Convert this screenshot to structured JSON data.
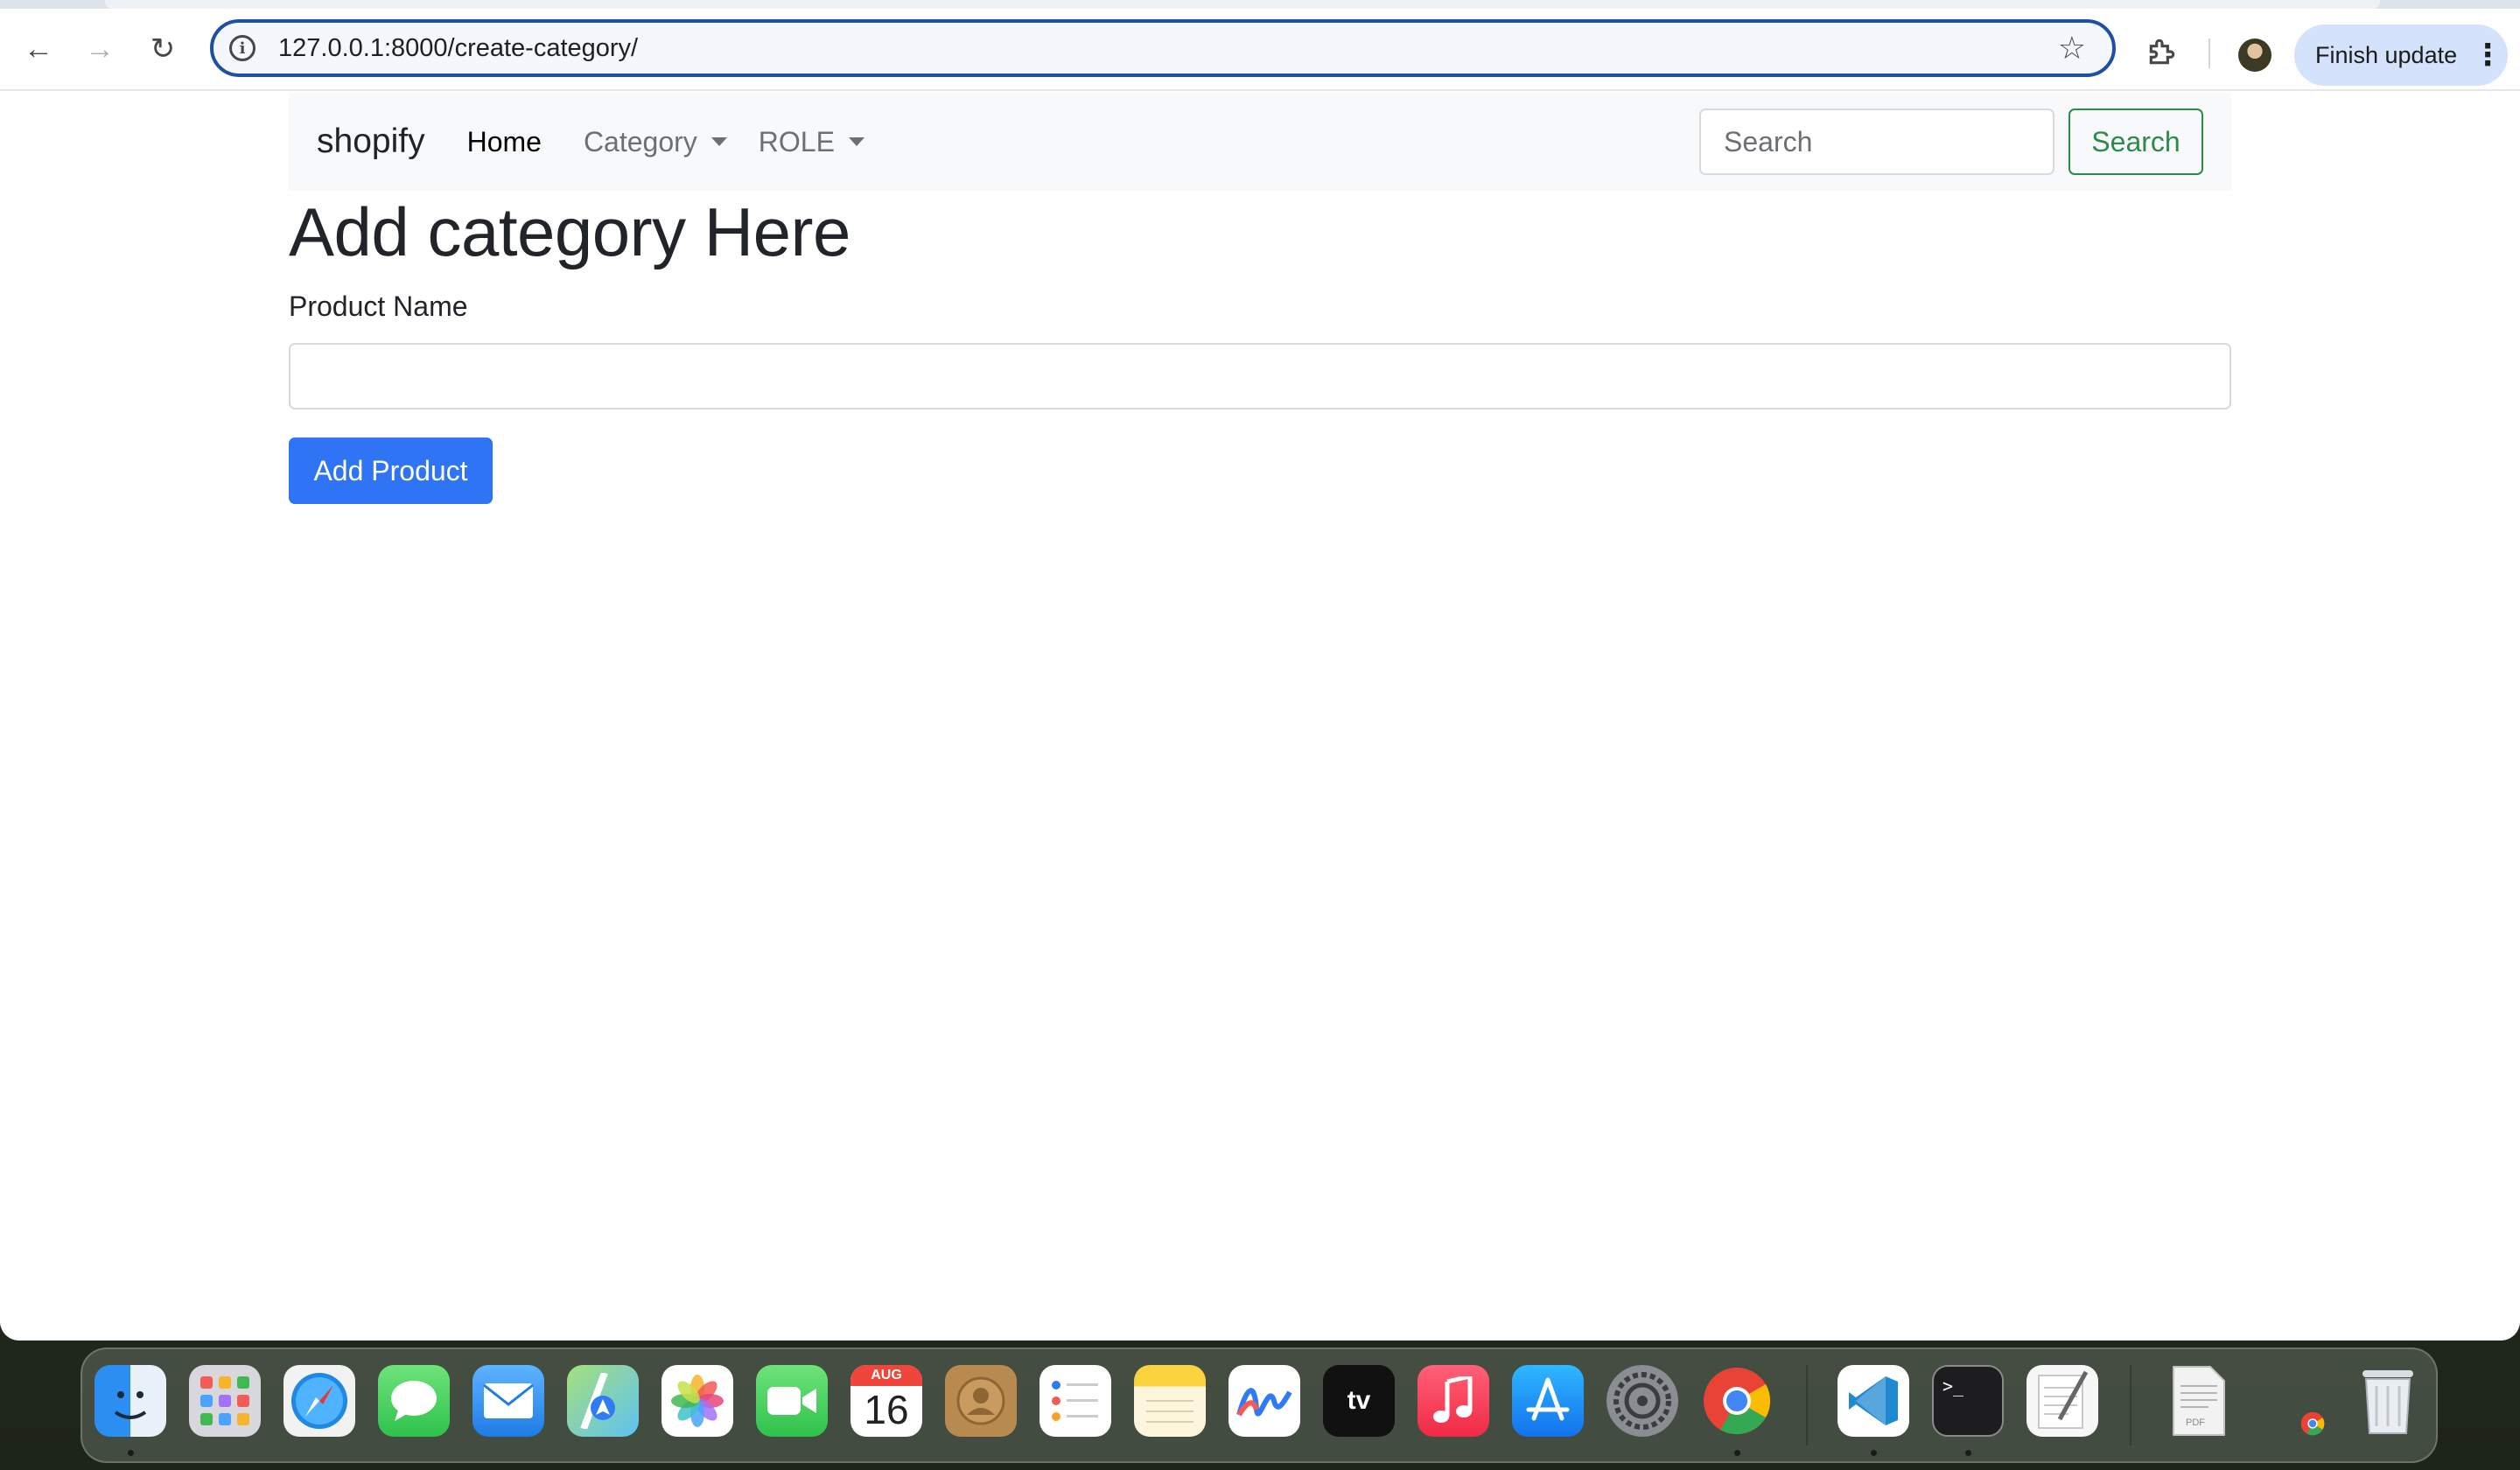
{
  "browser": {
    "url": "127.0.0.1:8000/create-category/",
    "finish_update_label": "Finish update"
  },
  "navbar": {
    "brand": "shopify",
    "links": [
      {
        "label": "Home"
      },
      {
        "label": "Category"
      },
      {
        "label": "ROLE"
      }
    ],
    "search_placeholder": "Search",
    "search_button": "Search"
  },
  "form": {
    "title": "Add category Here",
    "field_label": "Product Name",
    "field_value": "",
    "submit_label": "Add Product"
  },
  "dock": {
    "calendar_month": "AUG",
    "calendar_day": "16",
    "tv_label": "tv",
    "pdf_label": "PDF",
    "apps": [
      "finder-icon",
      "launchpad-icon",
      "safari-icon",
      "messages-icon",
      "mail-icon",
      "maps-icon",
      "photos-icon",
      "facetime-icon",
      "calendar-icon",
      "contacts-icon",
      "reminders-icon",
      "notes-icon",
      "freeform-icon",
      "apple-tv-icon",
      "music-icon",
      "app-store-icon",
      "system-settings-icon",
      "chrome-icon",
      "vscode-icon",
      "terminal-icon",
      "textedit-icon",
      "pdf-document-icon",
      "chrome-download-icon",
      "trash-icon"
    ]
  },
  "colors": {
    "primary_button": "#2f74f4",
    "success_outline": "#2d8a4a",
    "navbar_bg": "#f8f9fa",
    "omnibox_border": "#1f4fa0"
  }
}
